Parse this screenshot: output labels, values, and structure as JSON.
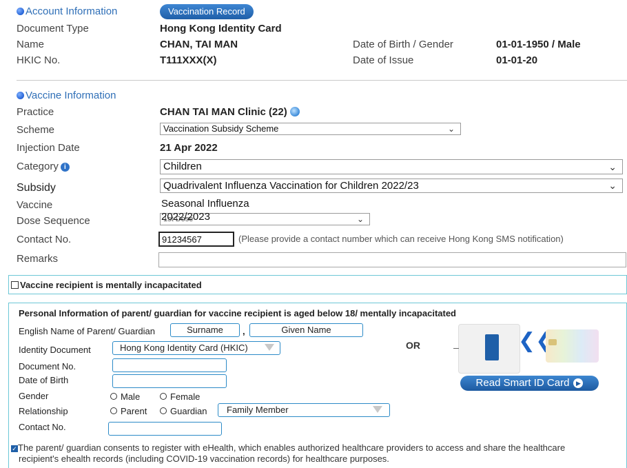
{
  "account": {
    "header": "Account Information",
    "tab_label": "Vaccination Record",
    "doc_type_label": "Document Type",
    "doc_type_value": "Hong Kong Identity Card",
    "name_label": "Name",
    "name_value": "CHAN, TAI MAN",
    "dob_label": "Date of Birth / Gender",
    "dob_value": "01-01-1950 / Male",
    "hkic_label": "HKIC No.",
    "hkic_value": "T111XXX(X)",
    "doi_label": "Date of Issue",
    "doi_value": "01-01-20"
  },
  "vaccine": {
    "header": "Vaccine Information",
    "practice_label": "Practice",
    "practice_value": "CHAN TAI MAN Clinic (22)",
    "scheme_label": "Scheme",
    "scheme_value": "Vaccination Subsidy Scheme",
    "injection_label": "Injection Date",
    "injection_value": "21 Apr 2022",
    "category_label": "Category",
    "category_value": "Children",
    "subsidy_label": "Subsidy",
    "subsidy_value": "Quadrivalent Influenza Vaccination for Children 2022/23",
    "vaccine_label": "Vaccine",
    "vaccine_value": "Seasonal Influenza",
    "dose_label": "Dose Sequence",
    "dose_value_overlay": "2022/2023",
    "dose_value_under": "1st Dose",
    "contact_label": "Contact No.",
    "contact_value": "91234567",
    "contact_hint": "(Please provide a contact number which can receive Hong Kong SMS notification)",
    "remarks_label": "Remarks",
    "remarks_value": ""
  },
  "mental": {
    "checkbox_label": "Vaccine recipient is mentally incapacitated",
    "checked": false
  },
  "guardian": {
    "title": "Personal Information of parent/ guardian for vaccine recipient is aged below 18/ mentally incapacitated",
    "eng_name_label": "English Name of Parent/ Guardian",
    "surname_placeholder": "Surname",
    "comma": ",",
    "given_placeholder": "Given Name",
    "id_doc_label": "Identity Document",
    "id_doc_value": "Hong Kong Identity Card (HKIC)",
    "doc_no_label": "Document No.",
    "dob_label": "Date of Birth",
    "gender_label": "Gender",
    "gender_male": "Male",
    "gender_female": "Female",
    "relationship_label": "Relationship",
    "rel_parent": "Parent",
    "rel_guardian": "Guardian",
    "rel_select_value": "Family Member",
    "contact_label": "Contact No.",
    "or_text": "OR",
    "read_button": "Read Smart ID Card",
    "consent_text_1": "The parent/ guardian consents to register with eHealth, which enables authorized healthcare providers to access and share the healthcare",
    "consent_text_2": "recipient's ehealth records (including COVID-19 vaccination records) for healthcare purposes.",
    "consent_checked": true
  },
  "colors": {
    "section_header": "#2f6fb7",
    "tab_bg": "#2a6fba",
    "cyan_border": "#6cc7d6"
  }
}
